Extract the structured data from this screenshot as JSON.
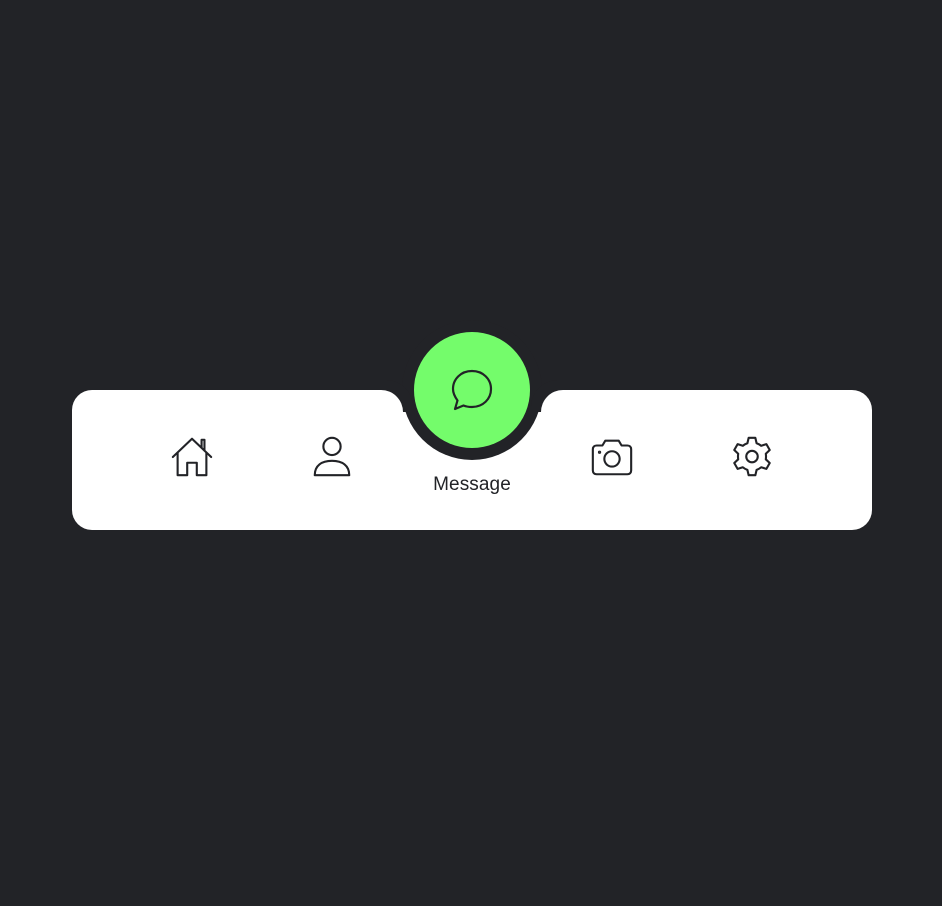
{
  "nav": {
    "items": [
      {
        "id": "home",
        "icon": "home-icon",
        "label": ""
      },
      {
        "id": "profile",
        "icon": "person-icon",
        "label": ""
      },
      {
        "id": "message",
        "icon": "chat-bubble-icon",
        "label": "Message",
        "active": true
      },
      {
        "id": "camera",
        "icon": "camera-icon",
        "label": ""
      },
      {
        "id": "settings",
        "icon": "gear-icon",
        "label": ""
      }
    ],
    "active_label": "Message"
  },
  "colors": {
    "background": "#222327",
    "navbar": "#ffffff",
    "accent": "#74fc6b",
    "icon": "#222327"
  }
}
